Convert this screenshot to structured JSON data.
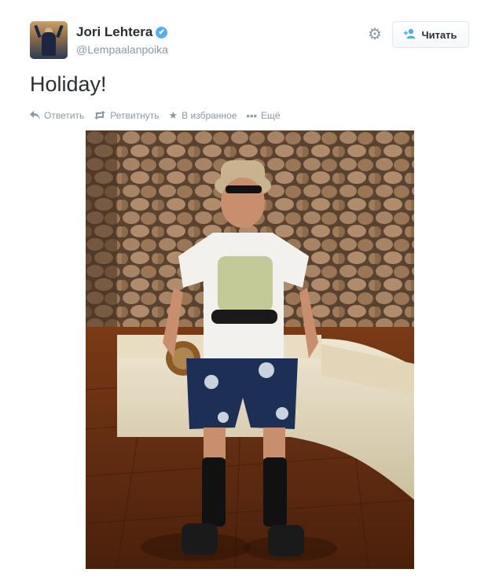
{
  "user": {
    "name": "Jori Lehtera",
    "handle": "@Lempaalanpoika",
    "verified_glyph": "✔"
  },
  "header": {
    "follow_label": "Читать",
    "follow_icon": "person-plus-icon",
    "settings_icon": "gear-icon"
  },
  "tweet": {
    "text": "Holiday!"
  },
  "actions": {
    "reply": "Ответить",
    "retweet": "Ретвитнуть",
    "favorite": "В избранное",
    "more": "Ещё"
  },
  "colors": {
    "accent": "#55acee",
    "muted": "#8899a6",
    "text": "#292f33"
  }
}
